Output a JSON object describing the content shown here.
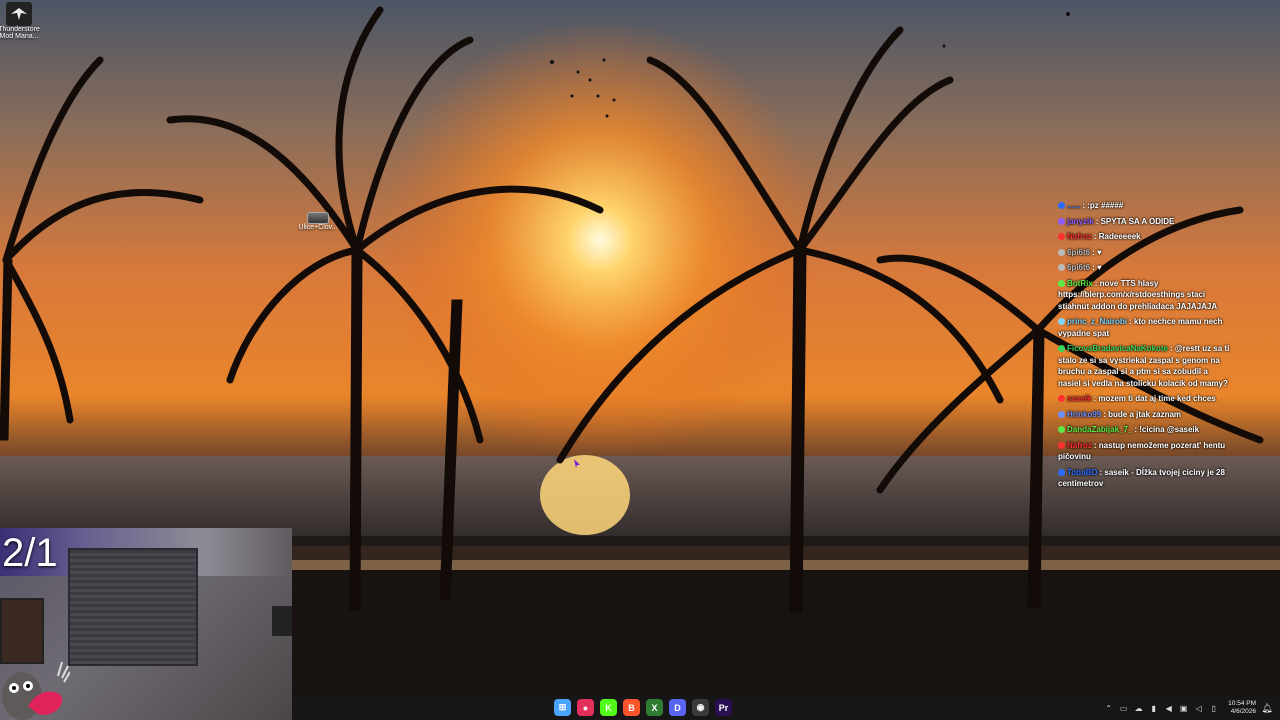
{
  "desktop": {
    "icons": [
      {
        "label": "Thunderstore Mod Mana...",
        "icon": "thunderstore-icon"
      },
      {
        "label": "Ulice+Clov...",
        "icon": "video-file-icon"
      }
    ]
  },
  "chat": {
    "messages": [
      {
        "user": "......",
        "color": "#2c6bff",
        "text": ":pz #####"
      },
      {
        "user": "janyzik",
        "color": "#8e5cff",
        "text": "SPYTA SA A ODIDE"
      },
      {
        "user": "Nafroz",
        "color": "#ff3030",
        "text": "Radeeeeek"
      },
      {
        "user": "6pi6t6",
        "color": "#bbbbbb",
        "text": "♥"
      },
      {
        "user": "6pi6t6",
        "color": "#bbbbbb",
        "text": "♥"
      },
      {
        "user": "BotRix",
        "color": "#5eea45",
        "text": "nove TTS hlasy https://blerp.com/x/rstdoesthings staci stiahnut addon do prehliadaca JAJAJAJA"
      },
      {
        "user": "princ_z_Nairobi",
        "color": "#7dd6ff",
        "text": "kto nechce mamu nech vypadne spat"
      },
      {
        "user": "FicovaBradavicaNaKokote",
        "color": "#3bd65b",
        "text": "@restt uz sa ti stalo ze si sa vystriekal zaspal s genom na bruchu a zaspal si a ptm si sa zobudil a nasiel si vedla na stolicku kolacik od mamy?"
      },
      {
        "user": "saseik",
        "color": "#ff3030",
        "text": "mozem ti dat aj time ked chces"
      },
      {
        "user": "Hrinko99",
        "color": "#6f8fff",
        "text": "bude a jtak zaznam"
      },
      {
        "user": "DandaZabijak_7_",
        "color": "#5eea45",
        "text": "!cicina @saseik"
      },
      {
        "user": "Nafroz",
        "color": "#ff3030",
        "text": "nastup nemožeme pozerat' hentu pičovinu"
      },
      {
        "user": "TobaBO",
        "color": "#2c6bff",
        "text": "saseik - Dĺžka tvojej ciciny je 28 centimetrov"
      }
    ]
  },
  "webcam": {
    "counter": "2/1"
  },
  "taskbar": {
    "apps": [
      {
        "name": "start",
        "icon": "windows-start-icon",
        "color": "#4aa3ff",
        "glyph": "⊞"
      },
      {
        "name": "maps",
        "icon": "map-pin-icon",
        "color": "#e3305a",
        "glyph": "●"
      },
      {
        "name": "kick",
        "icon": "kick-icon",
        "color": "#53fc18",
        "glyph": "K"
      },
      {
        "name": "brave",
        "icon": "brave-browser-icon",
        "color": "#fb542b",
        "glyph": "B"
      },
      {
        "name": "xbox",
        "icon": "xbox-icon",
        "color": "#2e7d32",
        "glyph": "X"
      },
      {
        "name": "discord",
        "icon": "discord-icon",
        "color": "#5865f2",
        "glyph": "D"
      },
      {
        "name": "obs",
        "icon": "obs-icon",
        "color": "#3a3a3a",
        "glyph": "◉"
      },
      {
        "name": "premiere",
        "icon": "premiere-pro-icon",
        "color": "#2a0f55",
        "glyph": "Pr"
      }
    ],
    "time": "10:54 PM",
    "date": "4/6/2026"
  }
}
